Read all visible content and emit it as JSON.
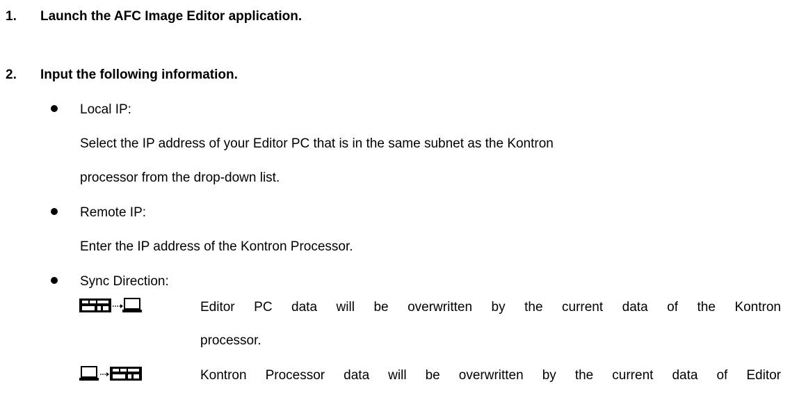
{
  "steps": [
    {
      "number": "1.",
      "text": "Launch the AFC Image Editor application."
    },
    {
      "number": "2.",
      "text": "Input the following information."
    }
  ],
  "items": {
    "local_ip": {
      "label": "Local IP:",
      "desc_line1": "Select the IP address of your Editor PC that is in the same subnet as the Kontron",
      "desc_line2": "processor from the drop-down list."
    },
    "remote_ip": {
      "label": "Remote IP:",
      "desc": "Enter the IP address of the Kontron Processor."
    },
    "sync_direction": {
      "label": "Sync Direction:",
      "options": [
        {
          "icon": "processor-to-pc-icon",
          "line1": "Editor PC data will be overwritten by the current data of the Kontron",
          "line2": "processor."
        },
        {
          "icon": "pc-to-processor-icon",
          "line1": "Kontron Processor data will be overwritten by the current data of Editor"
        }
      ]
    }
  }
}
